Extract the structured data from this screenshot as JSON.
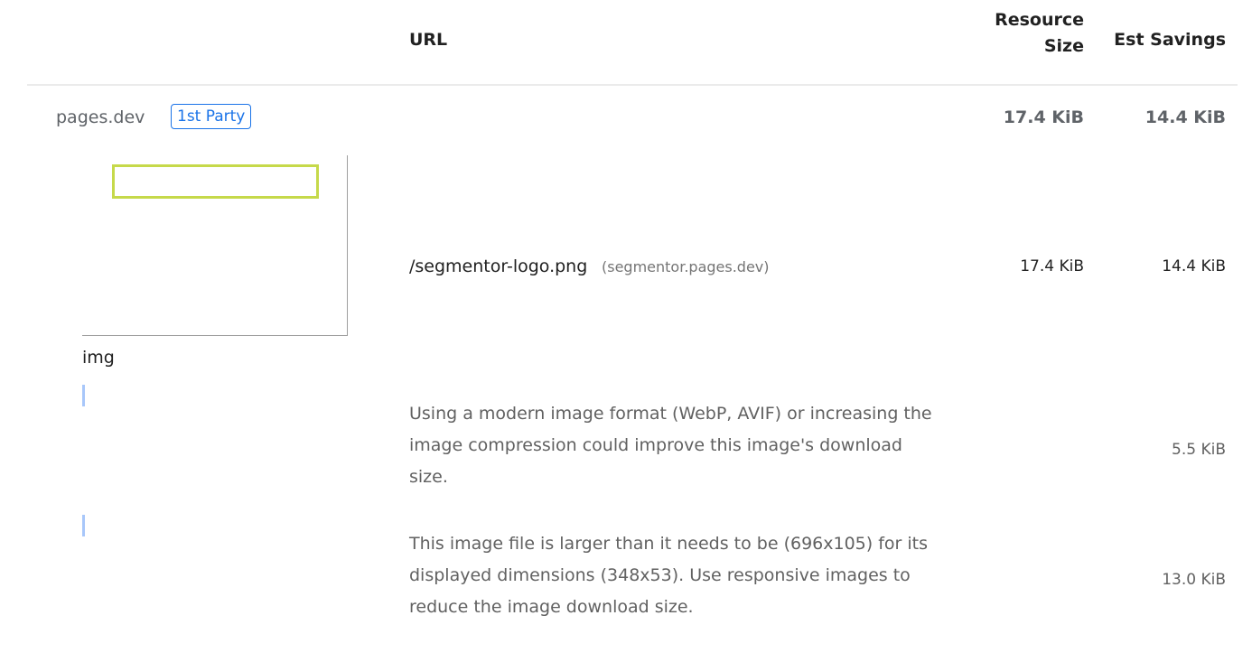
{
  "table": {
    "headers": {
      "url": "URL",
      "resource_size": [
        "Resource",
        "Size"
      ],
      "est_savings": "Est Savings"
    },
    "entity": {
      "name": "pages.dev",
      "badge": "1st Party",
      "resource_size": "17.4 KiB",
      "est_savings": "14.4 KiB"
    },
    "item": {
      "node_label": "img",
      "url_path": "/segmentor-logo.png",
      "url_host": "(segmentor.pages.dev)",
      "resource_size": "17.4 KiB",
      "est_savings": "14.4 KiB"
    },
    "sub_items": [
      {
        "description": "Using a modern image format (WebP, AVIF) or increasing the image compression could improve this image's download size.",
        "est_savings": "5.5 KiB"
      },
      {
        "description": "This image file is larger than it needs to be (696x105) for its displayed dimensions (348x53). Use responsive images to reduce the image download size.",
        "est_savings": "13.0 KiB"
      }
    ]
  },
  "colors": {
    "badge": "#1a73e8",
    "highlight": "#c6d94a",
    "sub_item_bar": "#a8c7fa",
    "muted_text": "#5f6368"
  }
}
